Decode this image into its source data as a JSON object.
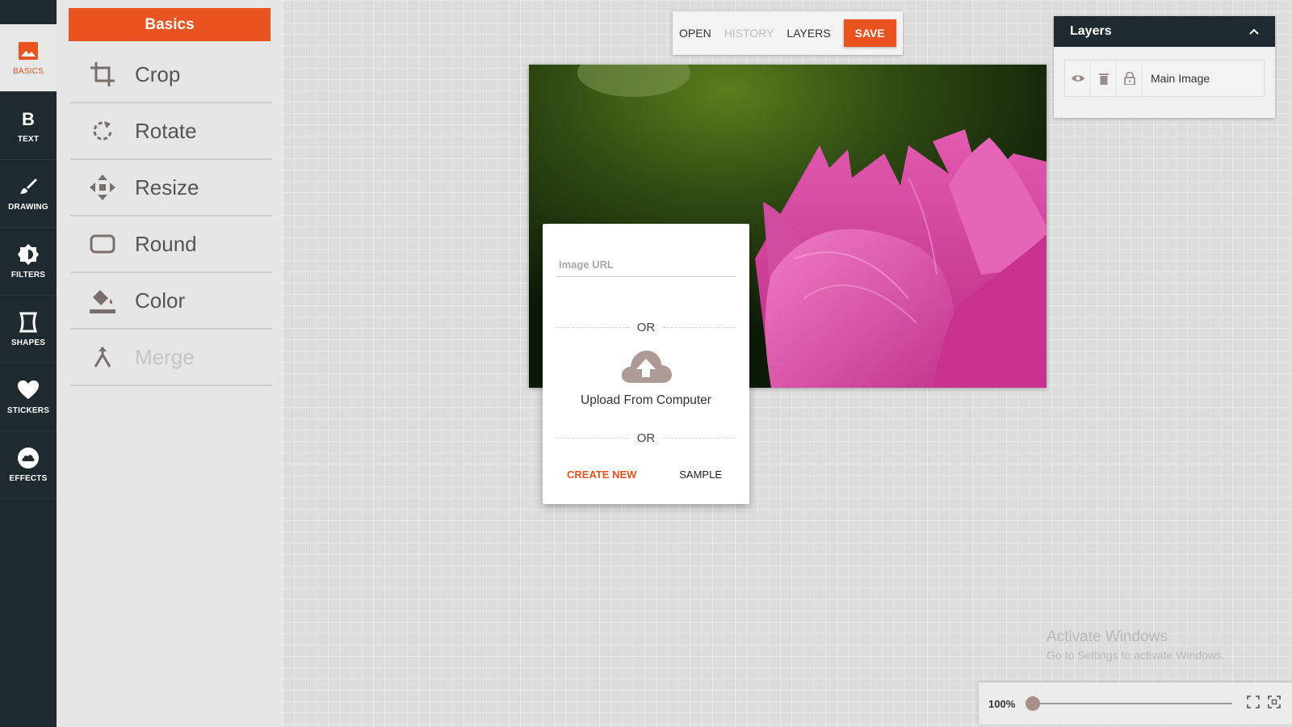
{
  "rail": {
    "items": [
      {
        "label": "BASICS",
        "icon": "image-icon",
        "active": true
      },
      {
        "label": "TEXT",
        "icon": "text-bold-icon"
      },
      {
        "label": "DRAWING",
        "icon": "brush-icon"
      },
      {
        "label": "FILTERS",
        "icon": "brightness-icon"
      },
      {
        "label": "SHAPES",
        "icon": "shape-icon"
      },
      {
        "label": "STICKERS",
        "icon": "heart-icon"
      },
      {
        "label": "EFFECTS",
        "icon": "cloud-icon"
      }
    ]
  },
  "panel": {
    "title": "Basics",
    "tools": [
      {
        "label": "Crop",
        "icon": "crop-icon"
      },
      {
        "label": "Rotate",
        "icon": "rotate-icon"
      },
      {
        "label": "Resize",
        "icon": "move-icon"
      },
      {
        "label": "Round",
        "icon": "rounded-rect-icon"
      },
      {
        "label": "Color",
        "icon": "paint-bucket-icon"
      },
      {
        "label": "Merge",
        "icon": "merge-icon",
        "disabled": true
      }
    ]
  },
  "toolbar": {
    "open": "OPEN",
    "history": "HISTORY",
    "layers": "LAYERS",
    "save": "SAVE"
  },
  "dialog": {
    "url_placeholder": "Image URL",
    "or1": "OR",
    "upload_label": "Upload From Computer",
    "or2": "OR",
    "create_new": "CREATE NEW",
    "sample": "SAMPLE"
  },
  "layers": {
    "title": "Layers",
    "rows": [
      {
        "name": "Main Image"
      }
    ]
  },
  "watermark": {
    "title": "Activate Windows",
    "subtitle": "Go to Settings to activate Windows."
  },
  "zoom": {
    "value": "100%",
    "level": 0.0
  },
  "colors": {
    "accent": "#e8531f",
    "rail_bg": "#1f2a30",
    "panel_bg": "#e6e6e6"
  }
}
